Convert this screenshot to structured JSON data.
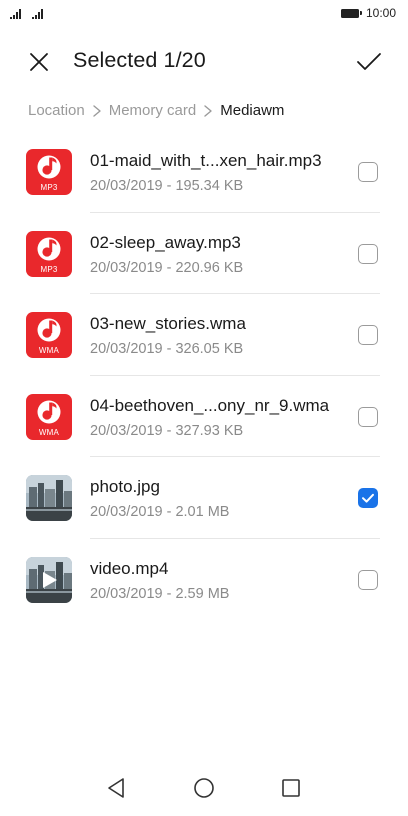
{
  "status_bar": {
    "time": "10:00"
  },
  "header": {
    "title": "Selected 1/20",
    "close_icon": "close-icon",
    "confirm_icon": "checkmark-icon"
  },
  "breadcrumb": {
    "items": [
      "Location",
      "Memory card",
      "Mediawm"
    ]
  },
  "files": [
    {
      "name": "01-maid_with_t...xen_hair.mp3",
      "meta": "20/03/2019 - 195.34 KB",
      "kind": "audio",
      "type_label": "MP3",
      "checked": false
    },
    {
      "name": "02-sleep_away.mp3",
      "meta": "20/03/2019 - 220.96 KB",
      "kind": "audio",
      "type_label": "MP3",
      "checked": false
    },
    {
      "name": "03-new_stories.wma",
      "meta": "20/03/2019 - 326.05 KB",
      "kind": "audio",
      "type_label": "WMA",
      "checked": false
    },
    {
      "name": "04-beethoven_...ony_nr_9.wma",
      "meta": "20/03/2019 - 327.93 KB",
      "kind": "audio",
      "type_label": "WMA",
      "checked": false
    },
    {
      "name": "photo.jpg",
      "meta": "20/03/2019 - 2.01 MB",
      "kind": "image",
      "checked": true
    },
    {
      "name": "video.mp4",
      "meta": "20/03/2019 - 2.59 MB",
      "kind": "video",
      "checked": false
    }
  ],
  "colors": {
    "accent": "#1a73e8",
    "music_icon": "#e9282c"
  },
  "nav": {
    "back_icon": "back-triangle-icon",
    "home_icon": "home-circle-icon",
    "recents_icon": "recents-square-icon"
  }
}
